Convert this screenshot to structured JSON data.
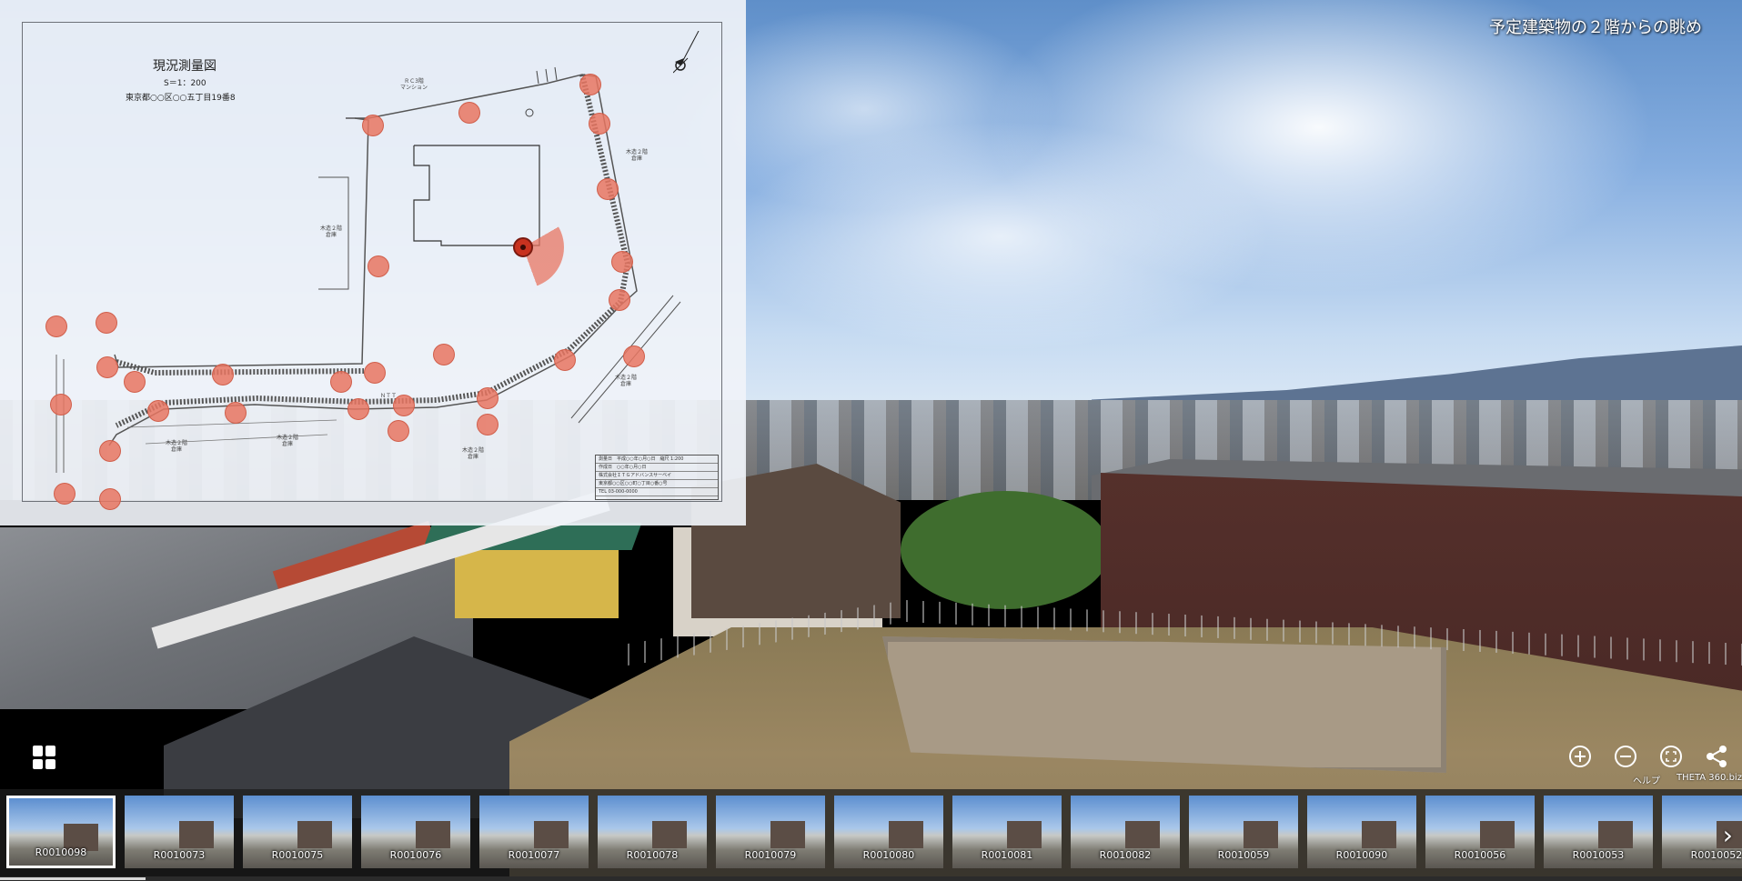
{
  "scene": {
    "title": "予定建築物の２階からの眺め"
  },
  "map": {
    "title": "現況測量図",
    "scale": "S＝1：200",
    "address": "東京都○○区○○五丁目19番8",
    "labels": {
      "mansion": "ＲＣ3階\nマンション",
      "neighbor_right": "木造２階\n倉庫",
      "neighbor_left": "木造２階\n倉庫",
      "ntt_pole": "ＮＴＴ",
      "neighbor_bottom_left": "木造２階\n倉庫",
      "neighbor_bottom_mid": "木造２階\n倉庫",
      "neighbor_bottom_right": "木造２階\n倉庫",
      "neighbor_far_right": "木造２階\n倉庫"
    },
    "title_block_rows": [
      "測量日　平成○○年○月○日　縮尺 1:200",
      "作成日　○○年○月○日",
      "株式会社ＩＴＧアドバンスサーベイ",
      "東京都○○区○○町○丁目○番○号",
      "TEL 03-000-0000"
    ],
    "current_view": "R0010098"
  },
  "controls": {
    "help_label": "ヘルプ",
    "brand_label": "THETA 360.biz"
  },
  "thumbnails": [
    {
      "label": "R0010098",
      "active": true
    },
    {
      "label": "R0010073",
      "active": false
    },
    {
      "label": "R0010075",
      "active": false
    },
    {
      "label": "R0010076",
      "active": false
    },
    {
      "label": "R0010077",
      "active": false
    },
    {
      "label": "R0010078",
      "active": false
    },
    {
      "label": "R0010079",
      "active": false
    },
    {
      "label": "R0010080",
      "active": false
    },
    {
      "label": "R0010081",
      "active": false
    },
    {
      "label": "R0010082",
      "active": false
    },
    {
      "label": "R0010059",
      "active": false
    },
    {
      "label": "R0010090",
      "active": false
    },
    {
      "label": "R0010056",
      "active": false
    },
    {
      "label": "R0010053",
      "active": false
    },
    {
      "label": "R0010052",
      "active": false
    }
  ],
  "icons": {
    "grid": "grid-icon",
    "zoom_in": "zoom-in-icon",
    "zoom_out": "zoom-out-icon",
    "fullscreen": "fullscreen-icon",
    "share": "share-icon",
    "next": "chevron-right-icon"
  }
}
